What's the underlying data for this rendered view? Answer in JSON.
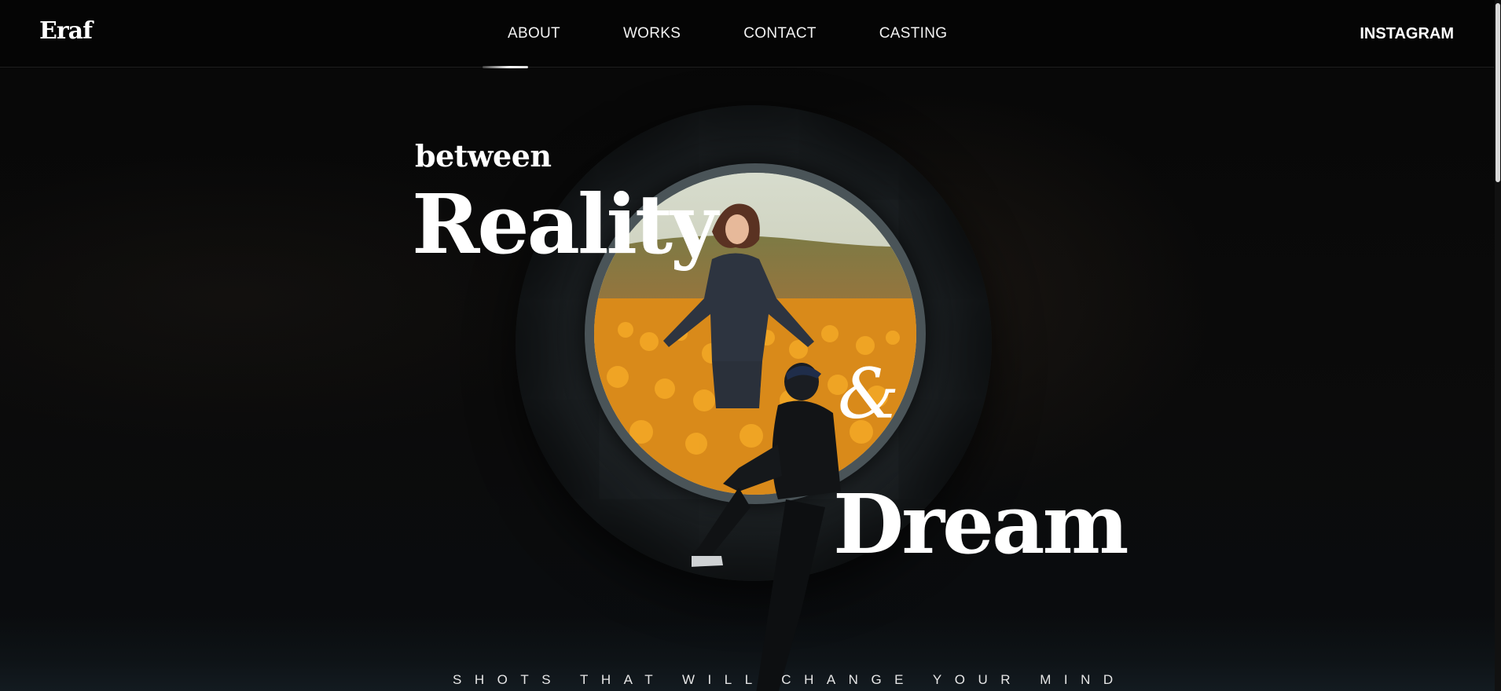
{
  "brand": {
    "logo_text": "Eraf"
  },
  "nav": {
    "items": [
      {
        "label": "ABOUT"
      },
      {
        "label": "WORKS"
      },
      {
        "label": "CONTACT"
      },
      {
        "label": "CASTING"
      }
    ],
    "active_index": 0,
    "social_label": "INSTAGRAM"
  },
  "hero": {
    "line1": "between",
    "line2": "Reality",
    "ampersand": "&",
    "line3": "Dream",
    "tagline": "SHOTS THAT WILL CHANGE YOUR MIND",
    "image_description_icon": "portal-photo"
  },
  "colors": {
    "background": "#060606",
    "text": "#ffffff",
    "accent_field": "#e49a1e"
  }
}
